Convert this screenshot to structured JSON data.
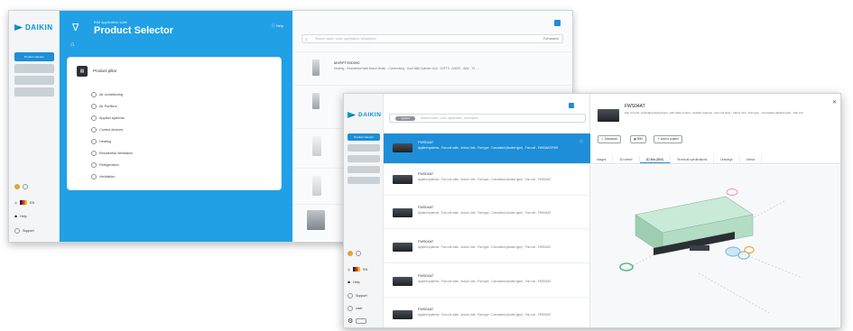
{
  "window1": {
    "logo": "DAIKIN",
    "sidebar": {
      "active_item": "Product selector",
      "items": [
        "",
        "",
        ""
      ],
      "footer": {
        "language": "EN",
        "help": "Help",
        "support": "Support"
      }
    },
    "header": {
      "subtitle": "BIM application suite",
      "title": "Product Selector",
      "help": "Help"
    },
    "card": {
      "title": "Product pillar",
      "options": [
        "Air conditioning",
        "Air Purifiers",
        "Applied systems",
        "Control devices",
        "Heating",
        "Residential Ventilation",
        "Refrigeration",
        "Ventilation"
      ]
    },
    "search": {
      "placeholder": "Search name, code, application, description",
      "button": "Full search"
    },
    "products": [
      {
        "title": "MXRPTS0D090",
        "desc": "Heating - Residential Wall-Mount Boiler - Condensing - Dual Wall Cylinder Unit - D2FT5 - A0009 - 4kW - 70 - ..."
      },
      {
        "title": "",
        "desc": ""
      },
      {
        "title": "",
        "desc": ""
      },
      {
        "title": "",
        "desc": ""
      },
      {
        "title": "",
        "desc": ""
      }
    ]
  },
  "window2": {
    "logo": "DAIKIN",
    "sidebar": {
      "active_item": "Product selector",
      "footer": {
        "language": "EN",
        "help": "Help",
        "support": "Support",
        "user": "User"
      }
    },
    "search": {
      "chip": "Applied",
      "placeholder": "Search name, code, application, description"
    },
    "rows": [
      {
        "title": "FWS04AT",
        "desc": "Applied systems - Fan coil units - Indoor Unit - Fan type - Concealed (ducted type) - Fan coil - FWS04AT/FWS"
      },
      {
        "title": "FWS04AT",
        "desc": "Applied systems - Fan coil units - Indoor Unit - Fan type - Concealed (ducted type) - Fan coil - FWS04AT"
      },
      {
        "title": "FWS04AT",
        "desc": "Applied systems - Fan coil units - Indoor Unit - Fan type - Concealed (ducted type) - Fan coil - FWS04AT"
      },
      {
        "title": "FWS04AT",
        "desc": "Applied systems - Fan coil units - Indoor Unit - Fan type - Concealed (ducted type) - Fan coil - FWS04AT"
      },
      {
        "title": "FWS04AT",
        "desc": "Applied systems - Fan coil units - Indoor Unit - Fan type - Concealed (ducted type) - Fan coil - FWS04AT"
      },
      {
        "title": "FWS04AT",
        "desc": "Applied systems - Fan coil units - Indoor Unit - Fan type - Concealed (ducted type) - Fan coil - FWS04AT"
      }
    ],
    "detail": {
      "title": "FWS04AT",
      "subtitle": "Fan coil unit, concealed ducted type, with valve control - Applied systems - Fan coil units - Indoor Unit - Fan type - Concealed (ducted type) - Fan coil",
      "buttons": [
        "Download",
        "BIM",
        "Add to project"
      ],
      "tabs": [
        "Images",
        "3D viewer",
        "3D files (BIM)",
        "Technical specifications",
        "Drawings",
        "Videos"
      ],
      "active_tab": "3D files (BIM)"
    },
    "colors": {
      "accent": "#1e8ed8",
      "header": "#21a0e6",
      "model": "#a8d8c0"
    }
  }
}
